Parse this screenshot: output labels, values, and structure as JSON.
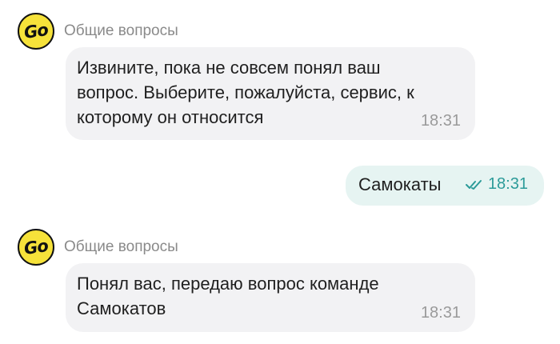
{
  "messages": [
    {
      "sender": "Общие вопросы",
      "avatar_text": "Go",
      "text": "Извините, пока не совсем понял ваш\nвопрос. Выберите, пожалуйста, сервис, к\nкоторому он относится",
      "time": "18:31"
    },
    {
      "outgoing": true,
      "text": "Самокаты",
      "time": "18:31",
      "status_icon": "double-check-icon"
    },
    {
      "sender": "Общие вопросы",
      "avatar_text": "Go",
      "text": "Понял вас, передаю вопрос команде\nСамокатов",
      "time": "18:31"
    }
  ],
  "colors": {
    "avatar_bg": "#f6e23a",
    "incoming_bubble": "#f2f2f4",
    "outgoing_bubble": "#e6f4f2",
    "outgoing_time": "#2c9b99"
  }
}
